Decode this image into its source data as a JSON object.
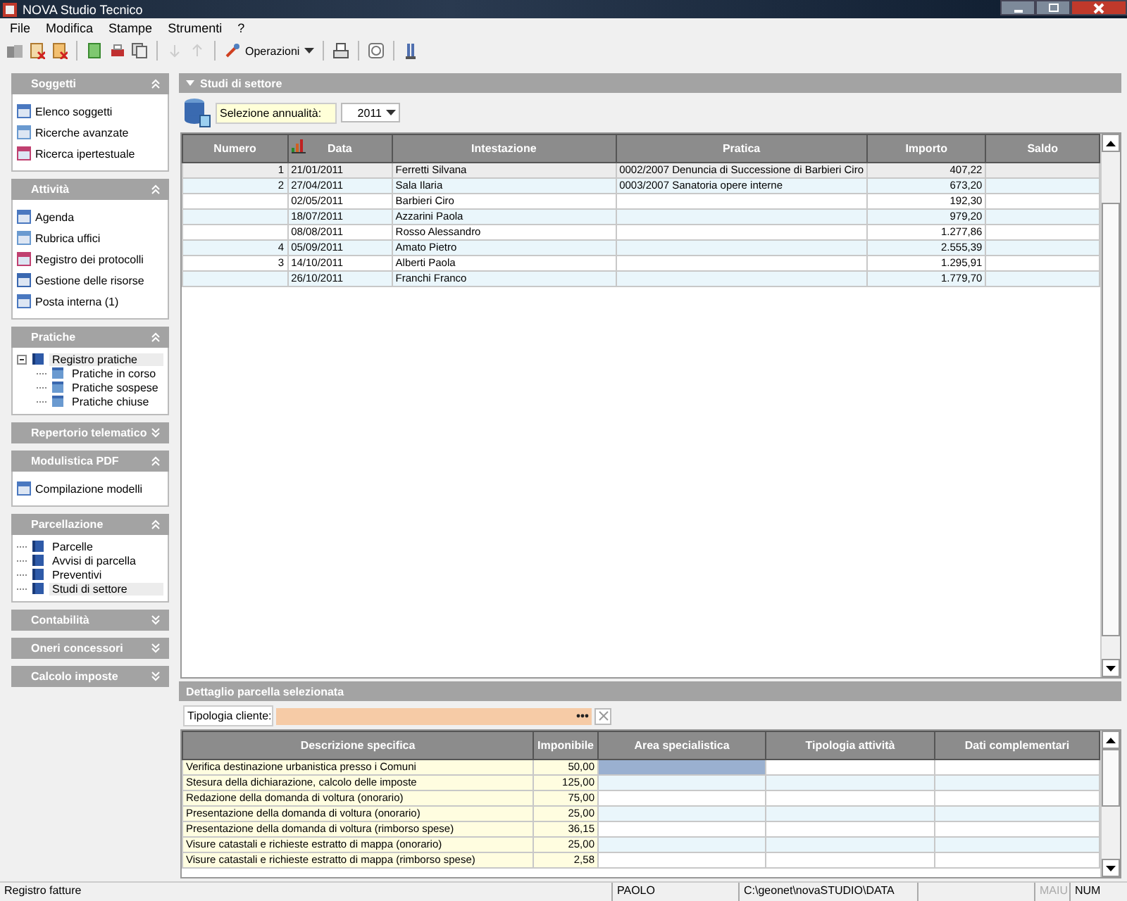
{
  "window": {
    "title": "NOVA Studio Tecnico"
  },
  "menu": [
    {
      "label": "File"
    },
    {
      "label": "Modifica"
    },
    {
      "label": "Stampe"
    },
    {
      "label": "Strumenti"
    },
    {
      "label": "?"
    }
  ],
  "toolbar": [
    {
      "kind": "button"
    },
    {
      "kind": "button"
    },
    {
      "kind": "button"
    },
    {
      "kind": "separator"
    },
    {
      "kind": "button"
    },
    {
      "kind": "button"
    },
    {
      "kind": "button"
    },
    {
      "kind": "separator"
    },
    {
      "kind": "button",
      "disabled": true
    },
    {
      "kind": "button",
      "disabled": true
    },
    {
      "kind": "separator"
    },
    {
      "kind": "dropdown",
      "label": "Operazioni"
    },
    {
      "kind": "separator"
    },
    {
      "kind": "button"
    },
    {
      "kind": "separator"
    },
    {
      "kind": "button"
    },
    {
      "kind": "separator"
    },
    {
      "kind": "button"
    }
  ],
  "sidebar": [
    {
      "title": "Soggetti",
      "expanded": true,
      "kind": "list",
      "items": [
        {
          "label": "Elenco soggetti"
        },
        {
          "label": "Ricerche avanzate"
        },
        {
          "label": "Ricerca ipertestuale"
        }
      ]
    },
    {
      "title": "Attività",
      "expanded": true,
      "kind": "list",
      "items": [
        {
          "label": "Agenda"
        },
        {
          "label": "Rubrica uffici"
        },
        {
          "label": "Registro dei protocolli"
        },
        {
          "label": "Gestione delle risorse"
        },
        {
          "label": "Posta interna (1)"
        }
      ]
    },
    {
      "title": "Pratiche",
      "expanded": true,
      "kind": "tree",
      "items": [
        {
          "label": "Registro pratiche",
          "selected": true,
          "expanded": true,
          "children": [
            {
              "label": "Pratiche in corso",
              "selected": false
            },
            {
              "label": "Pratiche sospese",
              "selected": false
            },
            {
              "label": "Pratiche chiuse",
              "selected": false
            }
          ]
        }
      ]
    },
    {
      "title": "Repertorio telematico",
      "expanded": false
    },
    {
      "title": "Modulistica PDF",
      "expanded": true,
      "kind": "list",
      "items": [
        {
          "label": "Compilazione modelli"
        }
      ]
    },
    {
      "title": "Parcellazione",
      "expanded": true,
      "kind": "tree",
      "items": [
        {
          "label": "Parcelle",
          "selected": false
        },
        {
          "label": "Avvisi di parcella",
          "selected": false
        },
        {
          "label": "Preventivi",
          "selected": false
        },
        {
          "label": "Studi di settore",
          "selected": true
        }
      ]
    },
    {
      "title": "Contabilità",
      "expanded": false
    },
    {
      "title": "Oneri concessori",
      "expanded": false
    },
    {
      "title": "Calcolo imposte",
      "expanded": false
    }
  ],
  "main": {
    "title": "Studi di settore",
    "filter_label": "Selezione annualità:",
    "year": "2011",
    "table": {
      "columns": [
        "Numero",
        "Data",
        "Intestazione",
        "Pratica",
        "Importo",
        "Saldo"
      ],
      "rows": [
        {
          "selected": true,
          "cells": [
            "1",
            "21/01/2011",
            "Ferretti Silvana",
            "0002/2007 Denuncia di Successione di Barbieri Ciro",
            "407,22",
            ""
          ]
        },
        {
          "selected": false,
          "cells": [
            "2",
            "27/04/2011",
            "Sala Ilaria",
            "0003/2007 Sanatoria opere interne",
            "673,20",
            ""
          ]
        },
        {
          "selected": false,
          "cells": [
            "",
            "02/05/2011",
            "Barbieri Ciro",
            "",
            "192,30",
            ""
          ]
        },
        {
          "selected": false,
          "cells": [
            "",
            "18/07/2011",
            "Azzarini Paola",
            "",
            "979,20",
            ""
          ]
        },
        {
          "selected": false,
          "cells": [
            "",
            "08/08/2011",
            "Rosso Alessandro",
            "",
            "1.277,86",
            ""
          ]
        },
        {
          "selected": false,
          "cells": [
            "4",
            "05/09/2011",
            "Amato Pietro",
            "",
            "2.555,39",
            ""
          ]
        },
        {
          "selected": false,
          "cells": [
            "3",
            "14/10/2011",
            "Alberti Paola",
            "",
            "1.295,91",
            ""
          ]
        },
        {
          "selected": false,
          "cells": [
            "",
            "26/10/2011",
            "Franchi Franco",
            "",
            "1.779,70",
            ""
          ]
        }
      ]
    }
  },
  "detail": {
    "title": "Dettaglio parcella selezionata",
    "client_label": "Tipologia cliente:",
    "table": {
      "columns": [
        "Descrizione specifica",
        "Imponibile",
        "Area specialistica",
        "Tipologia attività",
        "Dati complementari"
      ],
      "rows": [
        {
          "selected": true,
          "cells": [
            "Verifica destinazione urbanistica presso i Comuni",
            "50,00",
            "",
            "",
            ""
          ]
        },
        {
          "selected": false,
          "cells": [
            "Stesura della dichiarazione, calcolo delle imposte",
            "125,00",
            "",
            "",
            ""
          ]
        },
        {
          "selected": false,
          "cells": [
            "Redazione della domanda di voltura (onorario)",
            "75,00",
            "",
            "",
            ""
          ]
        },
        {
          "selected": false,
          "cells": [
            "Presentazione della domanda di voltura (onorario)",
            "25,00",
            "",
            "",
            ""
          ]
        },
        {
          "selected": false,
          "cells": [
            "Presentazione della domanda di voltura (rimborso spese)",
            "36,15",
            "",
            "",
            ""
          ]
        },
        {
          "selected": false,
          "cells": [
            "Visure catastali e richieste estratto di mappa (onorario)",
            "25,00",
            "",
            "",
            ""
          ]
        },
        {
          "selected": false,
          "cells": [
            "Visure catastali e richieste estratto di mappa (rimborso spese)",
            "2,58",
            "",
            "",
            ""
          ]
        }
      ]
    }
  },
  "status_bar": [
    {
      "text": "Registro fatture",
      "disabled": false
    },
    {
      "text": "PAOLO",
      "disabled": false
    },
    {
      "text": "C:\\geonet\\novaSTUDIO\\DATA",
      "disabled": false
    },
    {
      "text": "MAIU",
      "disabled": true
    },
    {
      "text": "NUM",
      "disabled": false
    }
  ]
}
